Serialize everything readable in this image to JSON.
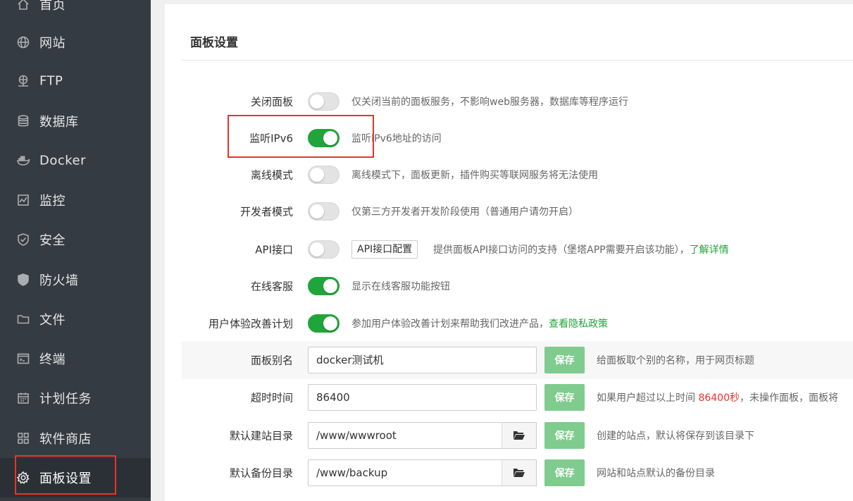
{
  "sidebar": {
    "items": [
      {
        "label": "首页",
        "icon": "home-icon"
      },
      {
        "label": "网站",
        "icon": "globe-icon"
      },
      {
        "label": "FTP",
        "icon": "ftp-icon"
      },
      {
        "label": "数据库",
        "icon": "database-icon"
      },
      {
        "label": "Docker",
        "icon": "docker-icon"
      },
      {
        "label": "监控",
        "icon": "monitor-chart-icon"
      },
      {
        "label": "安全",
        "icon": "shield-check-icon"
      },
      {
        "label": "防火墙",
        "icon": "firewall-shield-icon"
      },
      {
        "label": "文件",
        "icon": "folder-icon"
      },
      {
        "label": "终端",
        "icon": "terminal-icon"
      },
      {
        "label": "计划任务",
        "icon": "calendar-icon"
      },
      {
        "label": "软件商店",
        "icon": "grid-apps-icon"
      },
      {
        "label": "面板设置",
        "icon": "gear-icon",
        "active": true
      }
    ]
  },
  "main": {
    "title": "面板设置",
    "toggles": [
      {
        "label": "关闭面板",
        "on": false,
        "desc": "仅关闭当前的面板服务，不影响web服务器，数据库等程序运行"
      },
      {
        "label": "监听IPv6",
        "on": true,
        "desc": "监听IPv6地址的访问"
      },
      {
        "label": "离线模式",
        "on": false,
        "desc": "离线模式下，面板更新，插件购买等联网服务将无法使用"
      },
      {
        "label": "开发者模式",
        "on": false,
        "desc": "仅第三方开发者开发阶段使用（普通用户请勿开启）"
      },
      {
        "label": "API接口",
        "on": false,
        "button": "API接口配置",
        "desc": "提供面板API接口访问的支持（堡塔APP需要开启该功能），",
        "link": "了解详情"
      },
      {
        "label": "在线客服",
        "on": true,
        "desc": "显示在线客服功能按钮"
      },
      {
        "label": "用户体验改善计划",
        "on": true,
        "desc": "参加用户体验改善计划来帮助我们改进产品，",
        "link": "查看隐私政策"
      }
    ],
    "inputs": [
      {
        "label": "面板别名",
        "value": "docker测试机",
        "save": "保存",
        "desc": "给面板取个别的名称，用于网页标题"
      },
      {
        "label": "超时时间",
        "value": "86400",
        "save": "保存",
        "desc_pre": "如果用户超过以上时间 ",
        "desc_red": "86400秒",
        "desc_post": "，未操作面板，面板将"
      },
      {
        "label": "默认建站目录",
        "value": "/www/wwwroot",
        "save": "保存",
        "desc": "创建的站点，默认将保存到该目录下"
      },
      {
        "label": "默认备份目录",
        "value": "/www/backup",
        "save": "保存",
        "desc": "网站和站点默认的备份目录"
      }
    ]
  },
  "colors": {
    "accent": "#20a53a",
    "sidebar": "#353b42",
    "highlight": "#e8342c",
    "save": "#7fcc8e"
  }
}
